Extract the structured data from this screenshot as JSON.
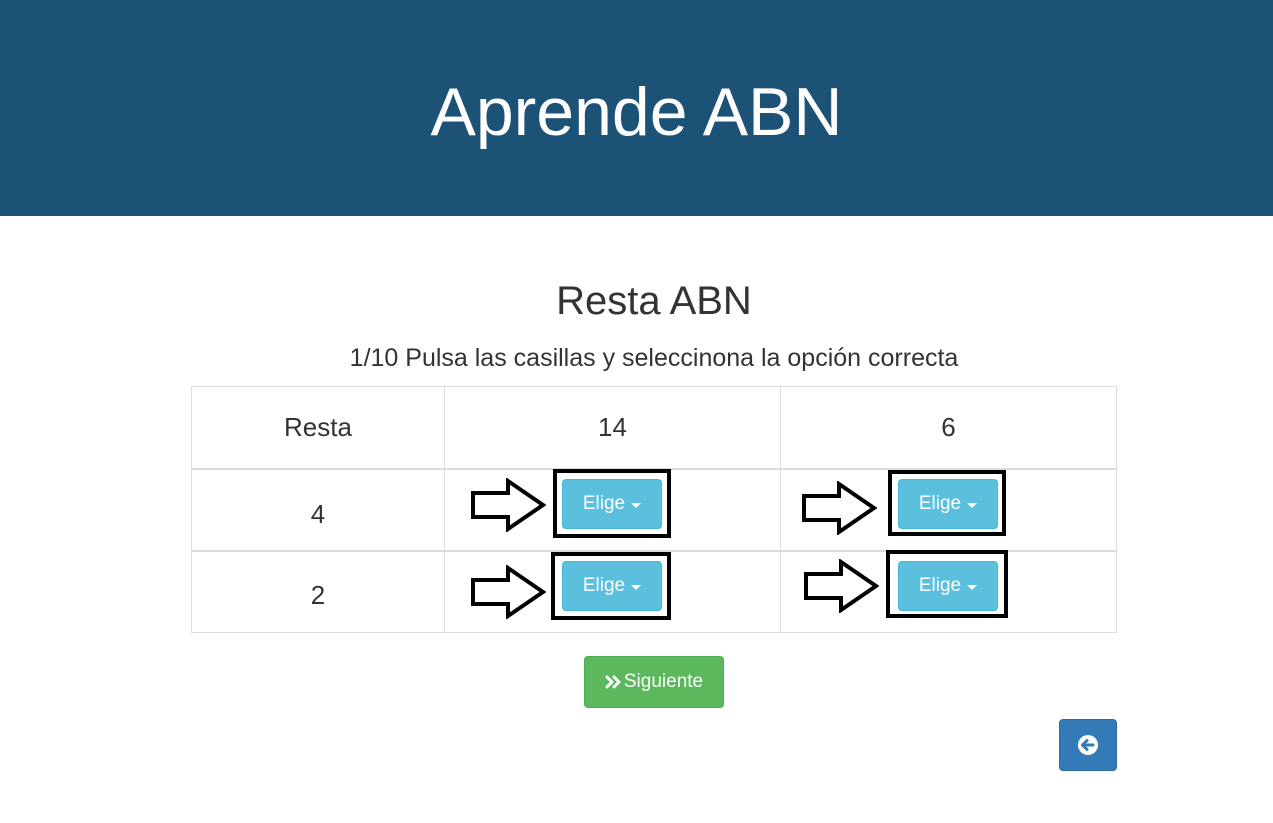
{
  "header": {
    "title": "Aprende ABN"
  },
  "main": {
    "title": "Resta ABN",
    "instructions": "1/10 Pulsa las casillas y seleccinona la opción correcta"
  },
  "table": {
    "header_row": [
      "Resta",
      "14",
      "6"
    ],
    "rows": [
      {
        "label": "4",
        "choices": [
          "Elige",
          "Elige"
        ]
      },
      {
        "label": "2",
        "choices": [
          "Elige",
          "Elige"
        ]
      }
    ]
  },
  "buttons": {
    "next_label": "Siguiente",
    "next_icon": "double-chevron-right-icon",
    "back_icon": "circle-arrow-left-icon"
  },
  "colors": {
    "header_bg": "#1c5276",
    "choice_button": "#5bc0de",
    "next_button": "#5cb85c",
    "back_button": "#337ab7"
  }
}
